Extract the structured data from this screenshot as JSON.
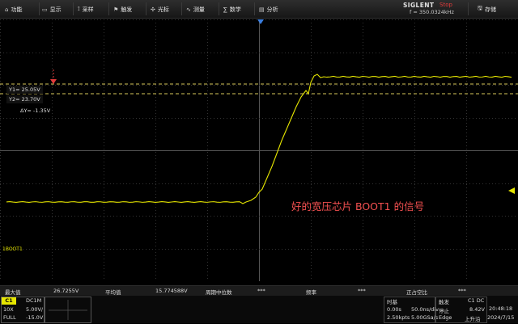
{
  "menu": {
    "items": [
      {
        "label": "功能",
        "icon": "function-icon",
        "glyph": "⌂"
      },
      {
        "label": "显示",
        "icon": "display-icon",
        "glyph": "▭"
      },
      {
        "label": "采样",
        "icon": "acquire-icon",
        "glyph": "⟟"
      },
      {
        "label": "触发",
        "icon": "trigger-icon",
        "glyph": "⚑"
      },
      {
        "label": "光标",
        "icon": "cursor-icon",
        "glyph": "✣"
      },
      {
        "label": "测量",
        "icon": "measure-icon",
        "glyph": "∿"
      },
      {
        "label": "数学",
        "icon": "math-icon",
        "glyph": "∑"
      },
      {
        "label": "分析",
        "icon": "analysis-icon",
        "glyph": "▤"
      }
    ],
    "brand": "SIGLENT",
    "run_state": "Stop",
    "frequency": "f = 350.0324kHz",
    "save_label": "存储",
    "save_icon_glyph": "🖫"
  },
  "cursors": {
    "y1": "Y1= 25.05V",
    "y2": "Y2= 23.70V",
    "dy": "ΔY= -1.35V"
  },
  "annotation": "好的宽压芯片 BOOT1 的信号",
  "channel_marker": "1BOOT1",
  "measurements": {
    "max_label": "最大值",
    "max_value": "26.7255V",
    "mean_label": "平均值",
    "mean_value": "15.774588V",
    "period_label": "周期中位数",
    "period_value": "***",
    "freq_label": "频率",
    "freq_value": "***",
    "pos_width_label": "正占空比",
    "pos_width_value": "***"
  },
  "channel": {
    "name": "C1",
    "coupling": "DC1M",
    "probe": "10X",
    "vdiv": "5.00V/",
    "bw": "FULL",
    "offset": "-15.0V"
  },
  "timebase": {
    "title": "时基",
    "delay": "0.00s",
    "tdiv": "50.0ns/div",
    "pts": "2.50kpts",
    "sample_rate": "5.00GSa/s"
  },
  "trigger": {
    "title": "触发",
    "channel": "C1 DC",
    "mode": "停止",
    "level": "8.42V",
    "edge": "上升沿",
    "mode2": "Edge"
  },
  "clock": {
    "time": "20:48:18",
    "date": "2024/7/15"
  },
  "colors": {
    "trace": "#e6e600",
    "cursor": "#d9c85a",
    "annotation": "#f25050",
    "stop": "#e23b3b"
  }
}
